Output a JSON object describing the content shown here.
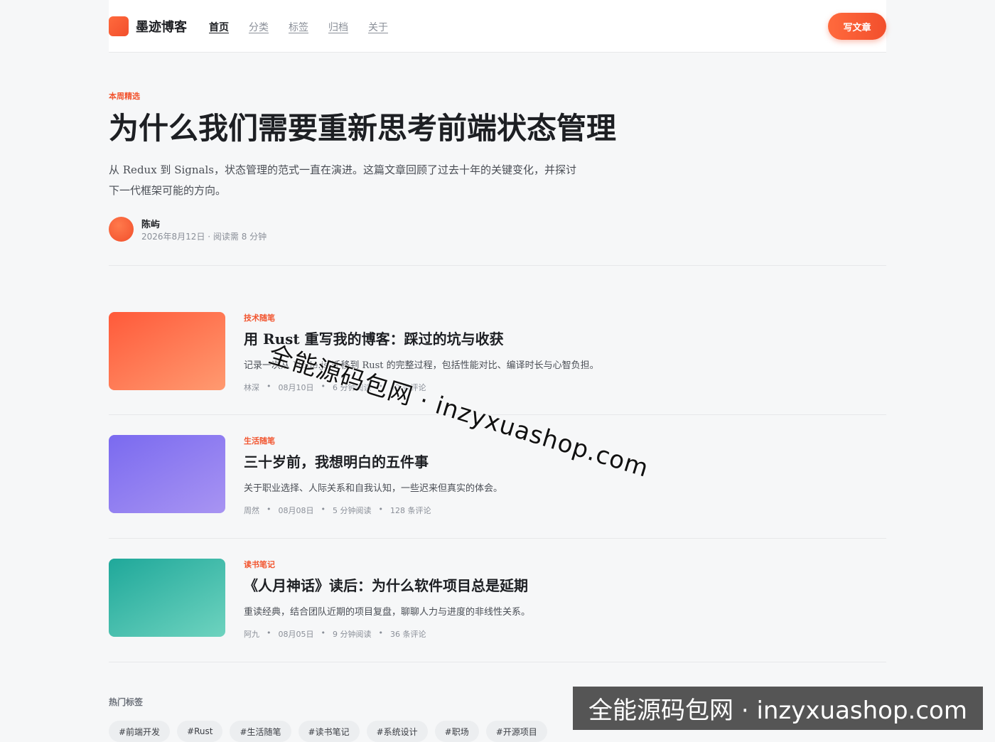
{
  "header": {
    "brand": "墨迹博客",
    "nav": [
      "首页",
      "分类",
      "标签",
      "归档",
      "关于"
    ],
    "write_button": "写文章"
  },
  "hero": {
    "eyebrow": "本周精选",
    "title": "为什么我们需要重新思考前端状态管理",
    "desc_line1": "从 Redux 到 Signals，状态管理的范式一直在演进。这篇文章回顾了过去十年的关键变化，并探讨",
    "desc_line2": "下一代框架可能的方向。",
    "author": "陈屿",
    "meta": "2026年8月12日 · 阅读需 8 分钟"
  },
  "posts": [
    {
      "category": "技术随笔",
      "title": "用 Rust 重写我的博客：踩过的坑与收获",
      "desc": "记录一次从 Node.js 迁移到 Rust 的完整过程，包括性能对比、编译时长与心智负担。",
      "author": "林深",
      "date": "08月10日",
      "read": "6 分钟阅读",
      "comments": "42 条评论",
      "gradient": [
        "#ff5a3a",
        "#ff9a70"
      ]
    },
    {
      "category": "生活随笔",
      "title": "三十岁前，我想明白的五件事",
      "desc": "关于职业选择、人际关系和自我认知，一些迟来但真实的体会。",
      "author": "周然",
      "date": "08月08日",
      "read": "5 分钟阅读",
      "comments": "128 条评论",
      "gradient": [
        "#7a6af0",
        "#a894f2"
      ]
    },
    {
      "category": "读书笔记",
      "title": "《人月神话》读后：为什么软件项目总是延期",
      "desc": "重读经典，结合团队近期的项目复盘，聊聊人力与进度的非线性关系。",
      "author": "阿九",
      "date": "08月05日",
      "read": "9 分钟阅读",
      "comments": "36 条评论",
      "gradient": [
        "#1fa89a",
        "#6ed3bf"
      ]
    }
  ],
  "tags_section": {
    "title": "热门标签",
    "tags": [
      "#前端开发",
      "#Rust",
      "#生活随笔",
      "#读书笔记",
      "#系统设计",
      "#职场",
      "#开源项目"
    ]
  },
  "watermark": {
    "diagonal": "全能源码包网 · inzyxuashop.com",
    "bar": "全能源码包网 · inzyxuashop.com"
  }
}
